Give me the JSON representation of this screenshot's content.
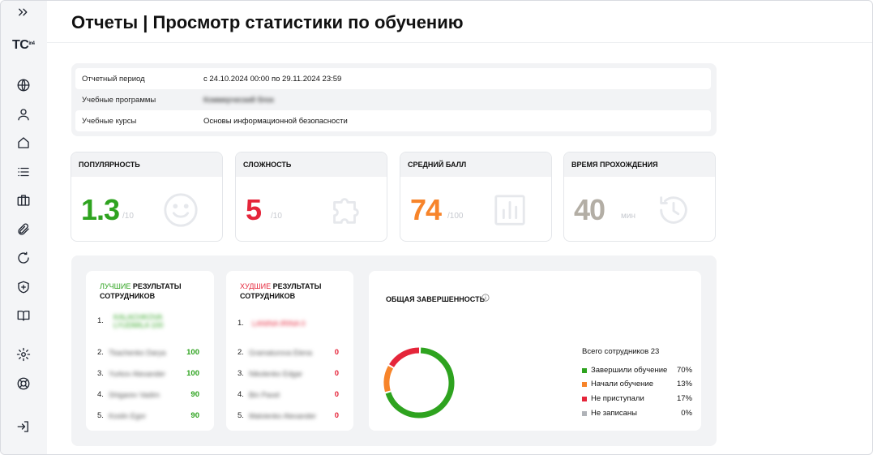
{
  "sidebar": {
    "logo": "TC",
    "logo_suffix": "in4",
    "items": [
      {
        "icon": "expand-icon"
      },
      {
        "icon": "globe-icon"
      },
      {
        "icon": "user-icon"
      },
      {
        "icon": "home-icon"
      },
      {
        "icon": "list-icon"
      },
      {
        "icon": "briefcase-icon"
      },
      {
        "icon": "paperclip-icon"
      },
      {
        "icon": "refresh-icon"
      },
      {
        "icon": "shield-plus-icon"
      },
      {
        "icon": "book-icon"
      },
      {
        "icon": "gear-icon"
      },
      {
        "icon": "lifebuoy-icon"
      },
      {
        "icon": "logout-icon"
      }
    ]
  },
  "header": {
    "title": "Отчеты | Просмотр статистики по обучению"
  },
  "filters": [
    {
      "label": "Отчетный период",
      "value": "с 24.10.2024 00:00 по 29.11.2024 23:59",
      "blurred": false
    },
    {
      "label": "Учебные программы",
      "value": "Коммерческий блок",
      "blurred": true
    },
    {
      "label": "Учебные курсы",
      "value": "Основы информационной безопасности",
      "blurred": false
    }
  ],
  "metrics": [
    {
      "title": "ПОПУЛЯРНОСТЬ",
      "value": "1.3",
      "unit": "/10",
      "color": "#2ea31f",
      "icon": "smile-icon"
    },
    {
      "title": "СЛОЖНОСТЬ",
      "value": "5",
      "unit": "/10",
      "color": "#e5253a",
      "icon": "puzzle-icon"
    },
    {
      "title": "СРЕДНИЙ БАЛЛ",
      "value": "74",
      "unit": "/100",
      "color": "#f7842a",
      "icon": "bar-chart-icon"
    },
    {
      "title": "ВРЕМЯ ПРОХОЖДЕНИЯ",
      "value": "40",
      "unit": "мин",
      "color": "#b3aea5",
      "icon": "history-icon"
    }
  ],
  "best": {
    "title_hl": "ЛУЧШИЕ",
    "title_rest": "РЕЗУЛЬТАТЫ СОТРУДНИКОВ",
    "color": "#2ea31f",
    "rows": [
      {
        "rank": "1.",
        "name": "KALACHKOVA LYUDMILA 100",
        "score": ""
      },
      {
        "rank": "2.",
        "name": "Tkachenko Darya",
        "score": "100"
      },
      {
        "rank": "3.",
        "name": "Yurkov Alexander",
        "score": "100"
      },
      {
        "rank": "4.",
        "name": "Shigarev Vadim",
        "score": "90"
      },
      {
        "rank": "5.",
        "name": "Koslin Egor",
        "score": "90"
      }
    ]
  },
  "worst": {
    "title_hl": "ХУДШИЕ",
    "title_rest": "РЕЗУЛЬТАТЫ СОТРУДНИКОВ",
    "color": "#e5253a",
    "rows": [
      {
        "rank": "1.",
        "name": "LANINA IRINA 0",
        "score": ""
      },
      {
        "rank": "2.",
        "name": "Gramaturova Elena",
        "score": "0"
      },
      {
        "rank": "3.",
        "name": "Nikolenko Edgar",
        "score": "0"
      },
      {
        "rank": "4.",
        "name": "Bin Pavel",
        "score": "0"
      },
      {
        "rank": "5.",
        "name": "Malvienko Alexander",
        "score": "0"
      }
    ]
  },
  "completion": {
    "title": "ОБЩАЯ ЗАВЕРШЕННОСТЬ",
    "total_label": "Всего сотрудников 23",
    "legend": [
      {
        "label": "Завершили обучение",
        "pct": "70%",
        "value": 70,
        "color": "#2ea31f"
      },
      {
        "label": "Начали обучение",
        "pct": "13%",
        "value": 13,
        "color": "#f7842a"
      },
      {
        "label": "Не приступали",
        "pct": "17%",
        "value": 17,
        "color": "#e5253a"
      },
      {
        "label": "Не записаны",
        "pct": "0%",
        "value": 0,
        "color": "#b0b3b8"
      }
    ]
  }
}
